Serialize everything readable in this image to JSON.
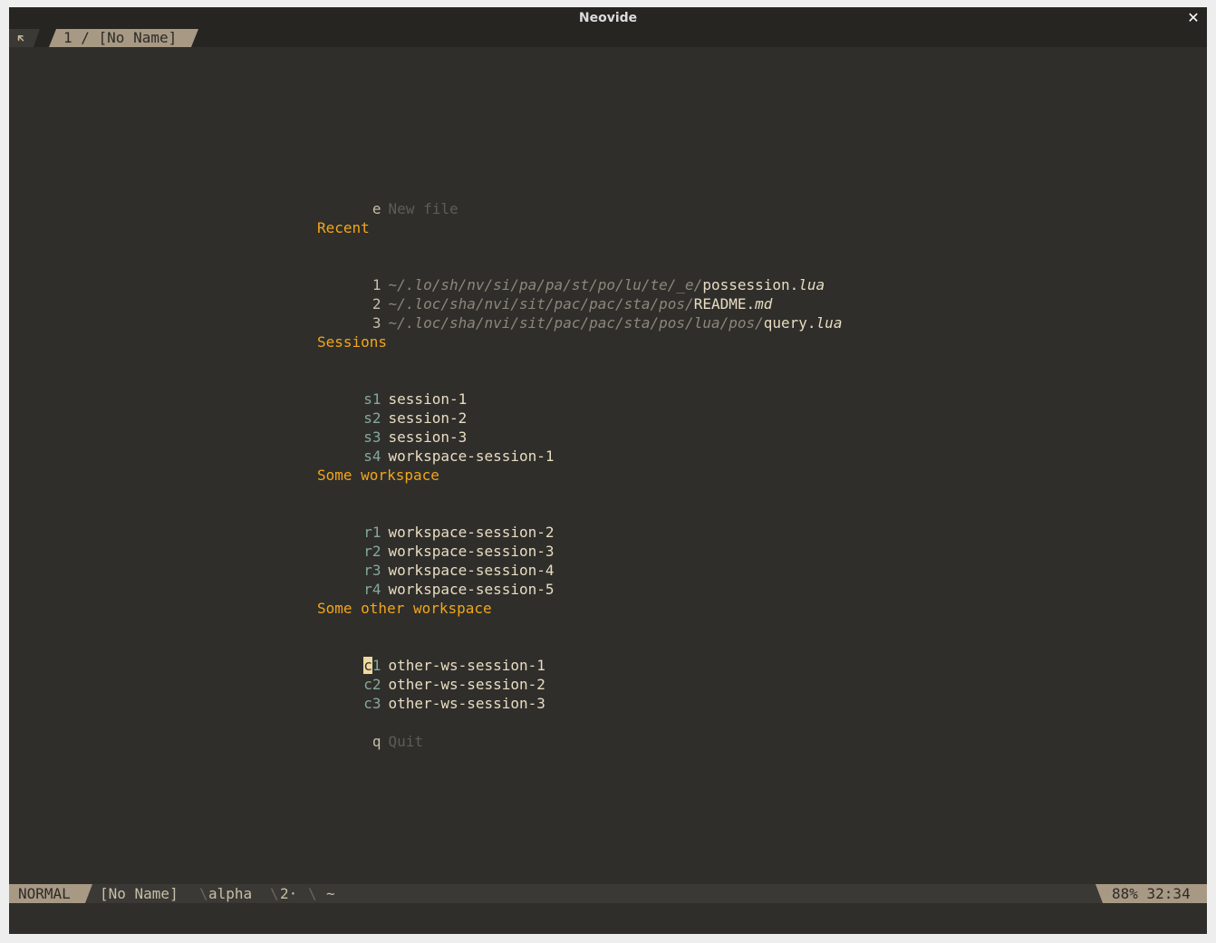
{
  "window": {
    "title": "Neovide",
    "close_glyph": "✕"
  },
  "tabline": {
    "icon": "🡴",
    "tab_label": "1 / [No Name]"
  },
  "dashboard": {
    "new_file": {
      "key": "e",
      "label": "New file"
    },
    "recent": {
      "title": "Recent",
      "items": [
        {
          "key": "1",
          "path": "~/.lo/sh/nv/si/pa/pa/st/po/lu/te/_e/",
          "name": "possession.",
          "ext": "lua"
        },
        {
          "key": "2",
          "path": "~/.loc/sha/nvi/sit/pac/pac/sta/pos/",
          "name": "README.",
          "ext": "md"
        },
        {
          "key": "3",
          "path": "~/.loc/sha/nvi/sit/pac/pac/sta/pos/lua/pos/",
          "name": "query.",
          "ext": "lua"
        }
      ]
    },
    "sessions": {
      "title": "Sessions",
      "items": [
        {
          "key": "s1",
          "label": "session-1"
        },
        {
          "key": "s2",
          "label": "session-2"
        },
        {
          "key": "s3",
          "label": "session-3"
        },
        {
          "key": "s4",
          "label": "workspace-session-1"
        }
      ]
    },
    "workspace": {
      "title": "Some workspace",
      "items": [
        {
          "key": "r1",
          "label": "workspace-session-2"
        },
        {
          "key": "r2",
          "label": "workspace-session-3"
        },
        {
          "key": "r3",
          "label": "workspace-session-4"
        },
        {
          "key": "r4",
          "label": "workspace-session-5"
        }
      ]
    },
    "other_workspace": {
      "title": "Some other workspace",
      "items": [
        {
          "key_first": "c",
          "key_rest": "1",
          "label": "other-ws-session-1"
        },
        {
          "key": "c2",
          "label": "other-ws-session-2"
        },
        {
          "key": "c3",
          "label": "other-ws-session-3"
        }
      ]
    },
    "quit": {
      "key": "q",
      "label": "Quit"
    }
  },
  "statusline": {
    "mode": "NORMAL",
    "file": "[No Name]",
    "separator": "\\",
    "filetype": "alpha",
    "count": "2·",
    "cwd": "~",
    "position": "88% 32:34"
  },
  "colors": {
    "background": "#2f2e2b",
    "header": "#f2a619",
    "key": "#85a89b",
    "text": "#e8dcc1",
    "muted": "#5e5c56",
    "accent_block": "#a89984"
  }
}
